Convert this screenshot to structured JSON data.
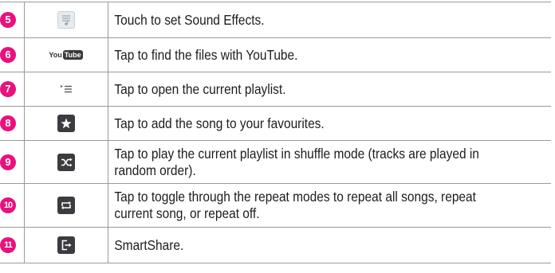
{
  "badge_color": "#e8117d",
  "rows": [
    {
      "number": "5",
      "icon": "sound-effects-icon",
      "description": "Touch to set Sound Effects."
    },
    {
      "number": "6",
      "icon": "youtube-icon",
      "icon_text": {
        "you": "You",
        "tube": "Tube"
      },
      "description": "Tap to find the files with YouTube."
    },
    {
      "number": "7",
      "icon": "playlist-icon",
      "description": "Tap to open the current playlist."
    },
    {
      "number": "8",
      "icon": "star-icon",
      "description": "Tap to add the song to your favourites."
    },
    {
      "number": "9",
      "icon": "shuffle-icon",
      "description": "Tap to play the current playlist in shuffle mode (tracks are played in random order)."
    },
    {
      "number": "10",
      "icon": "repeat-icon",
      "description": "Tap to toggle through the repeat modes to repeat all songs, repeat current song, or repeat off."
    },
    {
      "number": "11",
      "icon": "smartshare-icon",
      "description": "SmartShare."
    }
  ]
}
